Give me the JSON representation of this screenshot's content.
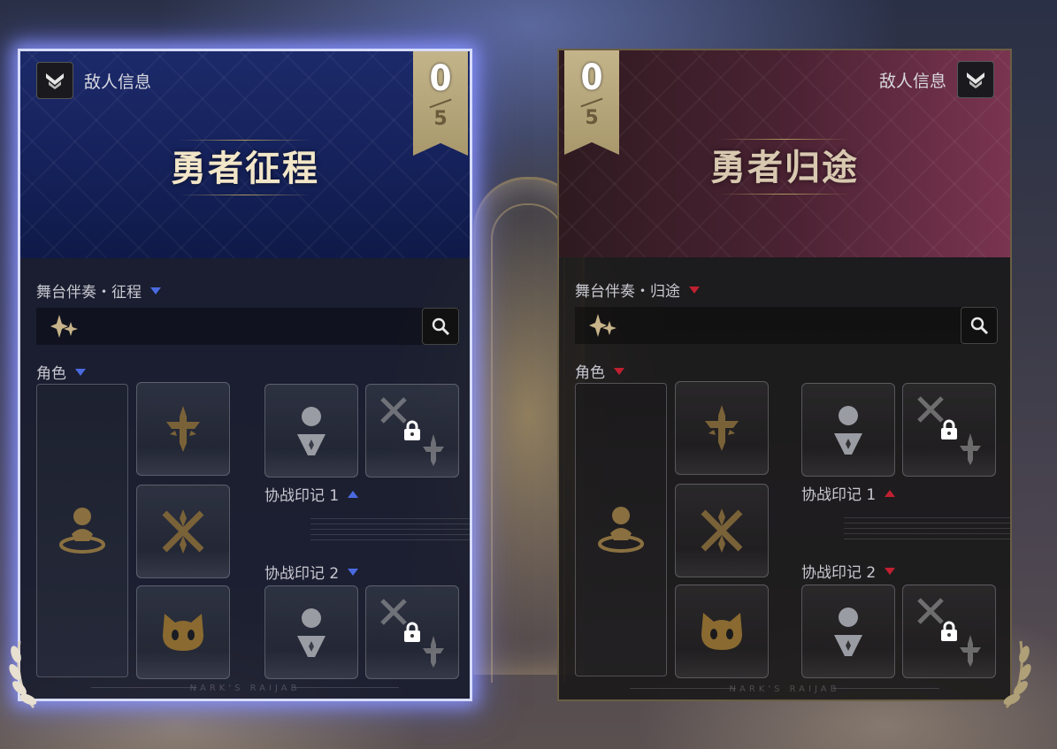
{
  "background": {
    "accent_left": "#7f8cff",
    "accent_right": "#c02030"
  },
  "panels": [
    {
      "side": "left",
      "enemy_info_label": "敌人信息",
      "progress_current": "0",
      "progress_total": "5",
      "title": "勇者征程",
      "accompaniment_label": "舞台伴奏・征程",
      "role_label": "角色",
      "support_seal_1_label": "协战印记 1",
      "support_seal_2_label": "协战印记 2",
      "footer": "NARK'S RAIJAB",
      "selected": true
    },
    {
      "side": "right",
      "enemy_info_label": "敌人信息",
      "progress_current": "0",
      "progress_total": "5",
      "title": "勇者归途",
      "accompaniment_label": "舞台伴奏・归途",
      "role_label": "角色",
      "support_seal_1_label": "协战印记 1",
      "support_seal_2_label": "协战印记 2",
      "footer": "NARK'S RAIJAB",
      "selected": false
    }
  ]
}
